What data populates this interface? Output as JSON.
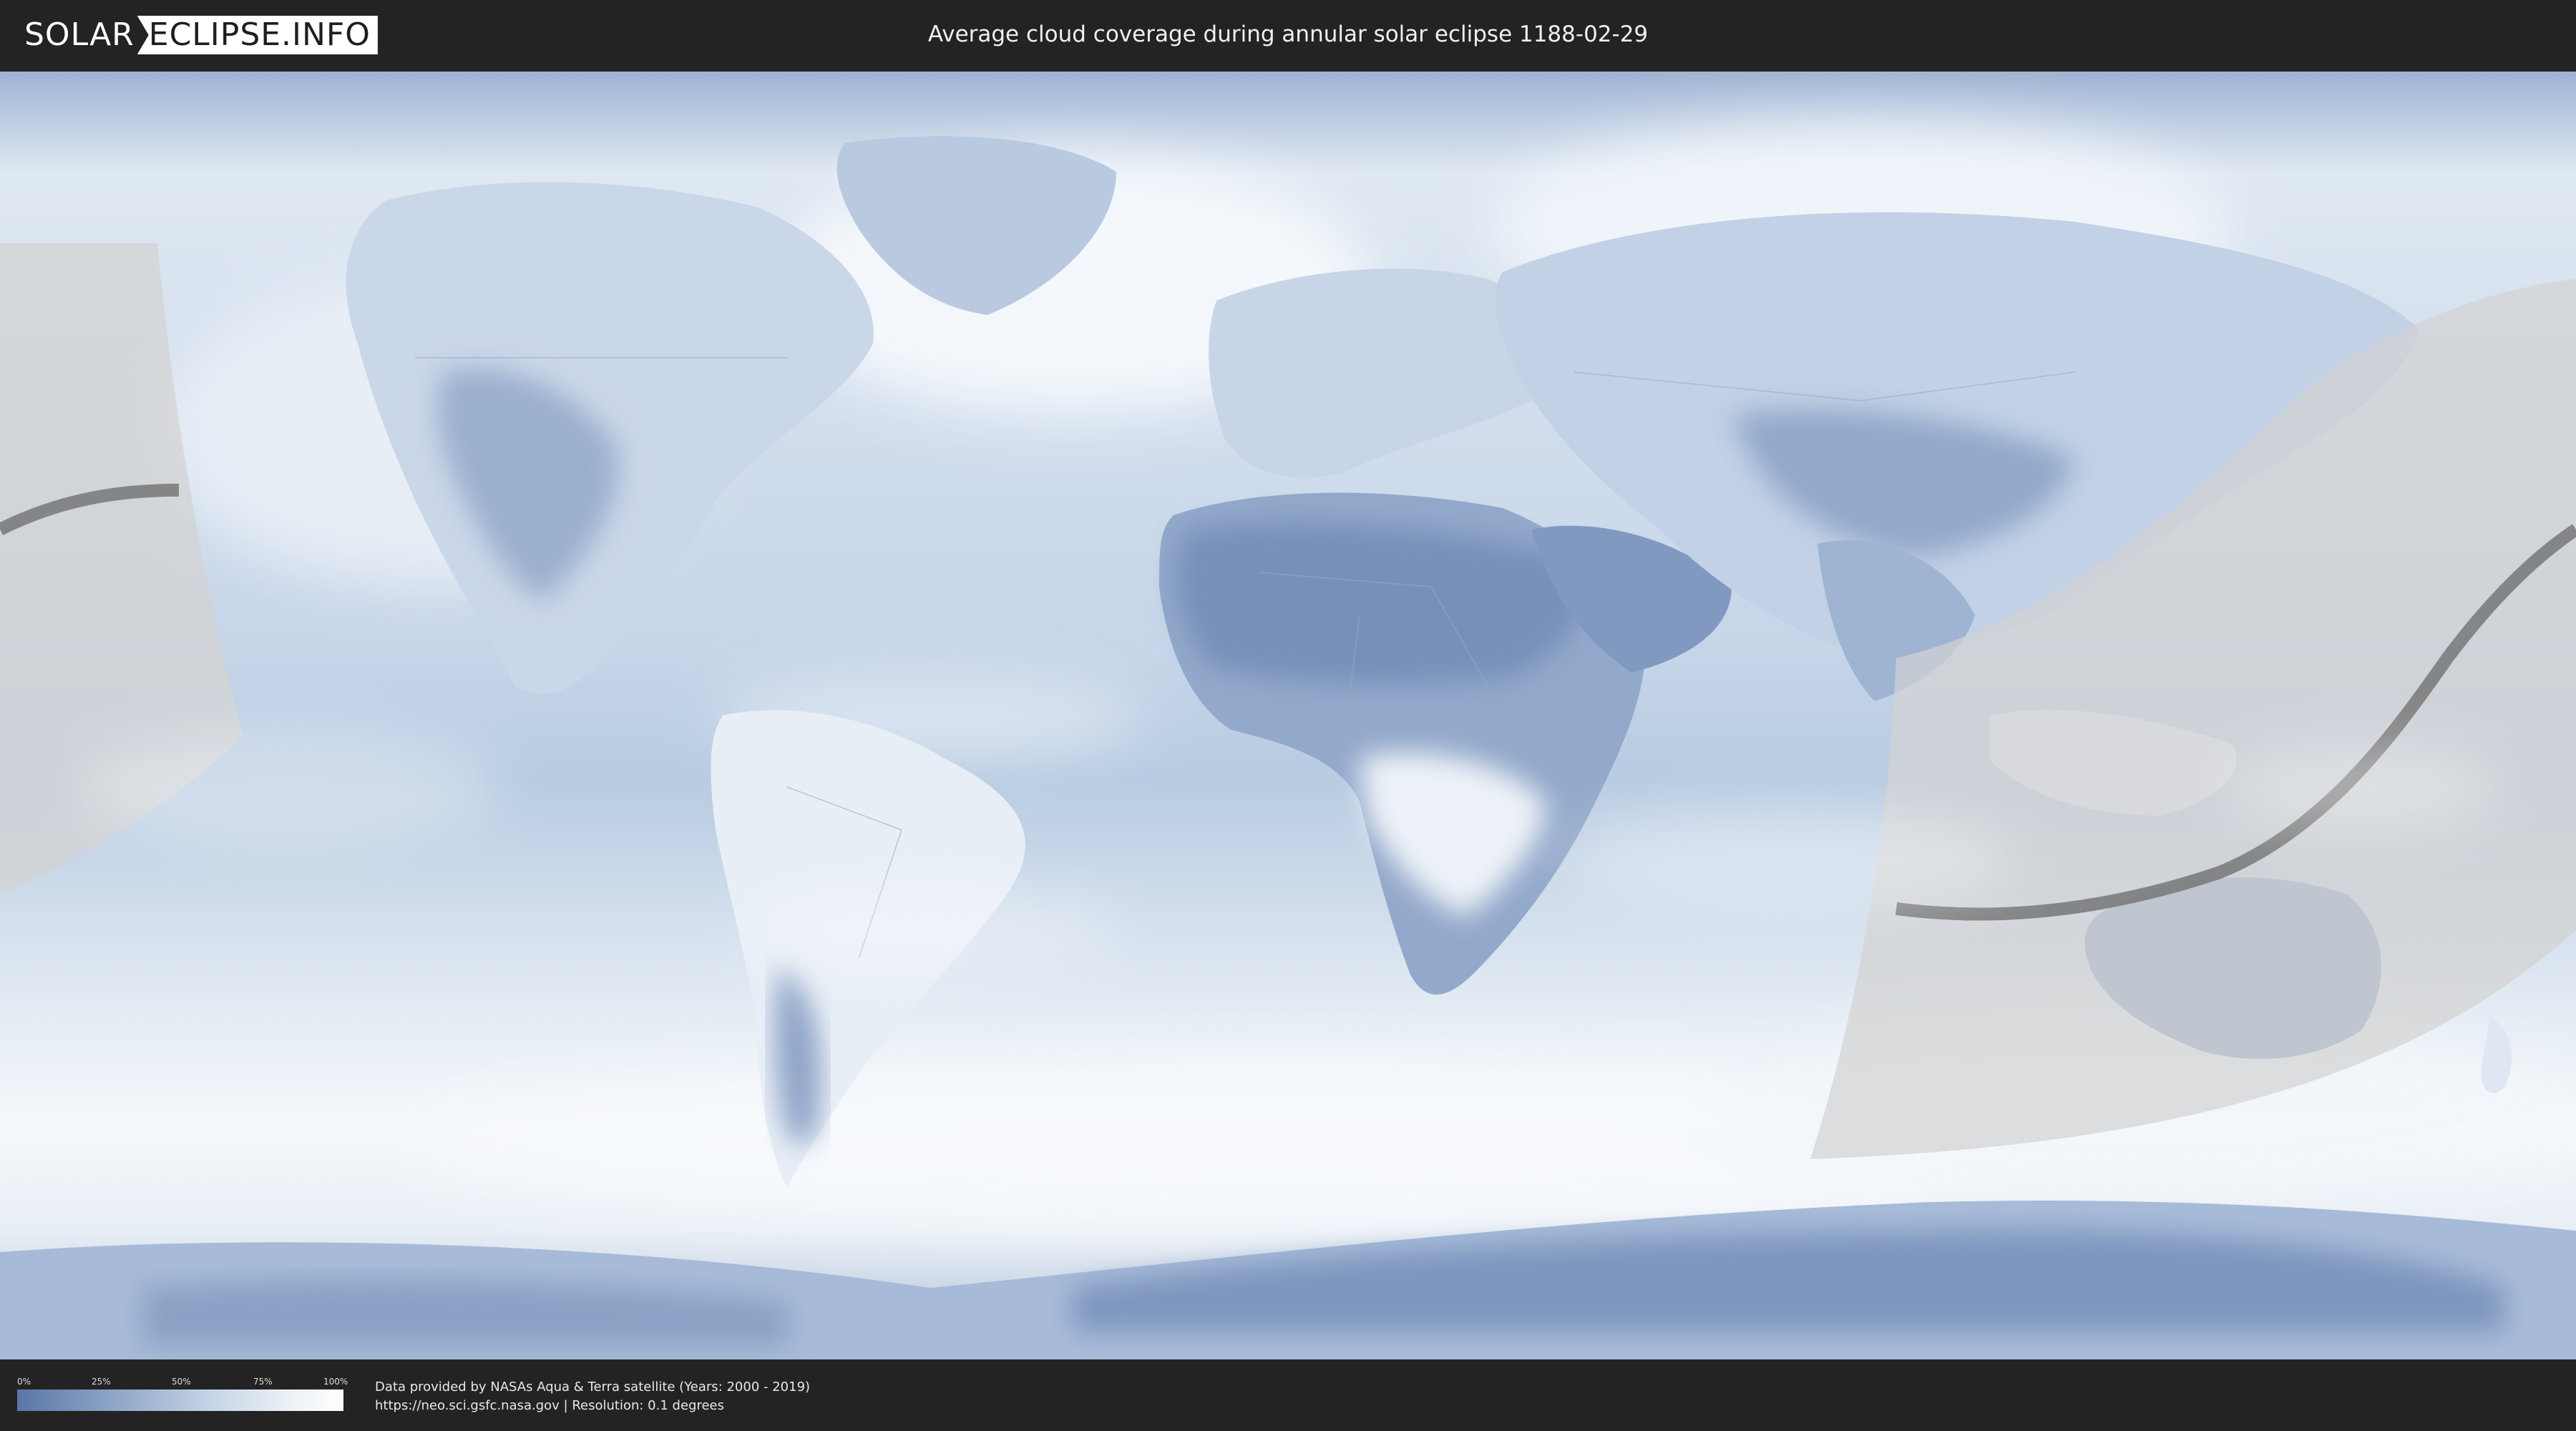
{
  "header": {
    "logo_left": "SOLAR",
    "logo_right": "ECLIPSE.INFO",
    "title": "Average cloud coverage during annular solar eclipse 1188-02-29"
  },
  "map": {
    "projection": "equirectangular",
    "layers": [
      "cloud-coverage",
      "country-borders",
      "eclipse-visibility-zone",
      "central-path"
    ],
    "colors": {
      "ocean_cloud": "#d9e3ef",
      "dry_land": "#7f97bf",
      "cloudy": "#f6f9fc",
      "eclipse_zone": "#d6d6d6",
      "central_path": "#7a7a7a"
    }
  },
  "legend": {
    "ticks": [
      "0%",
      "25%",
      "50%",
      "75%",
      "100%"
    ],
    "tick_values": [
      0,
      25,
      50,
      75,
      100
    ],
    "colors": [
      "#5a76a6",
      "#ffffff"
    ]
  },
  "footer": {
    "source_line_1": "Data provided by NASAs Aqua & Terra satellite (Years: 2000 - 2019)",
    "source_line_2": "https://neo.sci.gsfc.nasa.gov | Resolution: 0.1 degrees"
  }
}
